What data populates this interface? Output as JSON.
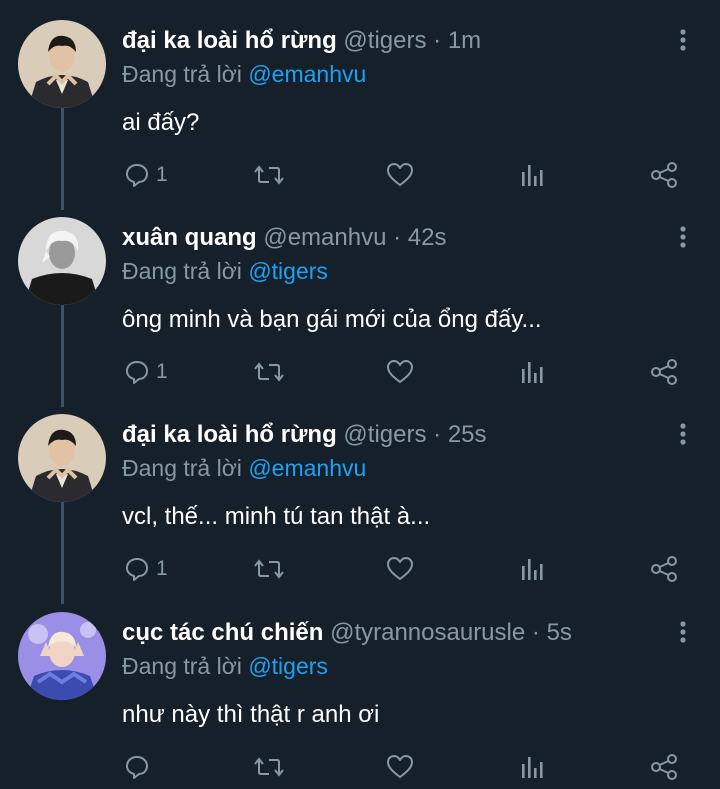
{
  "thread": {
    "tweets": [
      {
        "name": "đại ka loài hổ rừng",
        "handle": "@tigers",
        "time": "1m",
        "reply_prefix": "Đang trả lời",
        "reply_to": "@emanhvu",
        "text": "ai đấy?",
        "reply_count": "1",
        "avatar_colors": {
          "bg": "#d9cdb9",
          "fg": "#2b2a2e"
        }
      },
      {
        "name": "xuân quang",
        "handle": "@emanhvu",
        "time": "42s",
        "reply_prefix": "Đang trả lời",
        "reply_to": "@tigers",
        "text": "ông minh và bạn gái mới của ổng đấy...",
        "reply_count": "1",
        "avatar_colors": {
          "bg": "#5a5a5a",
          "fg": "#1a1a1a"
        }
      },
      {
        "name": "đại ka loài hổ rừng",
        "handle": "@tigers",
        "time": "25s",
        "reply_prefix": "Đang trả lời",
        "reply_to": "@emanhvu",
        "text": "vcl, thế... minh tú tan thật à...",
        "reply_count": "1",
        "avatar_colors": {
          "bg": "#d9cdb9",
          "fg": "#2b2a2e"
        }
      },
      {
        "name": "cục tác chú chiến",
        "handle": "@tyrannosaurusle",
        "time": "5s",
        "reply_prefix": "Đang trả lời",
        "reply_to": "@tigers",
        "text": "như này thì thật r anh ơi",
        "reply_count": "",
        "avatar_colors": {
          "bg": "#8a7fe0",
          "fg": "#3b4bb0"
        }
      }
    ]
  },
  "icons": {
    "reply": "reply-icon",
    "retweet": "retweet-icon",
    "like": "like-icon",
    "analytics": "analytics-icon",
    "share": "share-icon",
    "menu": "more-vertical-icon"
  },
  "colors": {
    "background": "#15202b",
    "secondary_text": "#8899a6",
    "mention": "#1da1f2",
    "thread_line": "#3d5466"
  }
}
